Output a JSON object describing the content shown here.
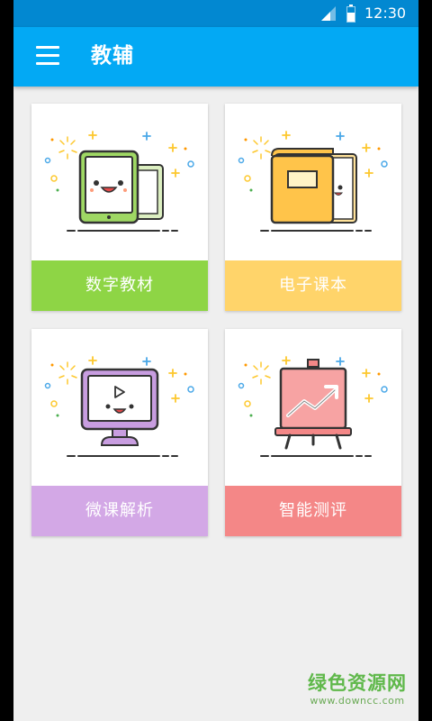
{
  "status_bar": {
    "time": "12:30"
  },
  "app_bar": {
    "title": "教辅"
  },
  "cards": [
    {
      "label": "数字教材",
      "color": "#8ed545",
      "icon": "tablet-icon"
    },
    {
      "label": "电子课本",
      "color": "#ffd46a",
      "icon": "book-icon"
    },
    {
      "label": "微课解析",
      "color": "#d3a8e6",
      "icon": "monitor-play-icon"
    },
    {
      "label": "智能测评",
      "color": "#f48787",
      "icon": "chart-board-icon"
    }
  ],
  "watermark": {
    "title": "绿色资源网",
    "url": "www.downcc.com"
  },
  "colors": {
    "status_bar": "#0288d1",
    "app_bar": "#03a9f4",
    "background": "#efefef"
  }
}
